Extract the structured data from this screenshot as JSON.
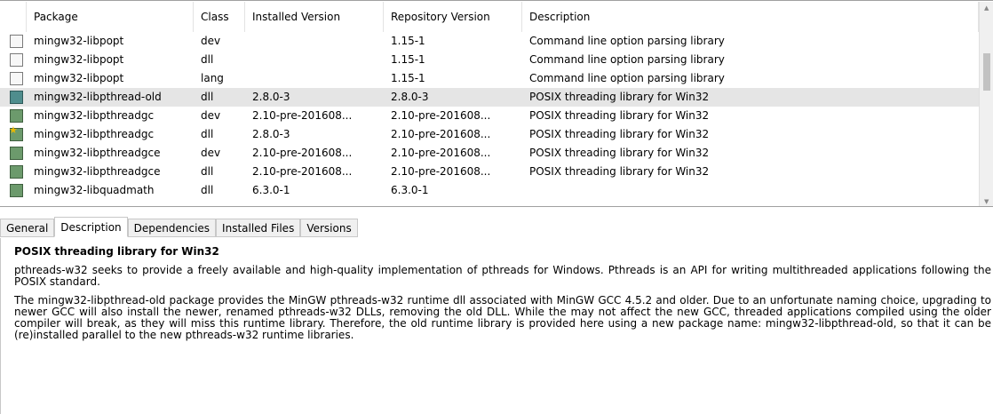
{
  "table": {
    "columns": [
      "Package",
      "Class",
      "Installed Version",
      "Repository Version",
      "Description"
    ],
    "rows": [
      {
        "state": "empty",
        "package": "mingw32-libpopt",
        "class": "dev",
        "installed": "",
        "repository": "1.15-1",
        "description": "Command line option parsing library"
      },
      {
        "state": "empty",
        "package": "mingw32-libpopt",
        "class": "dll",
        "installed": "",
        "repository": "1.15-1",
        "description": "Command line option parsing library"
      },
      {
        "state": "empty",
        "package": "mingw32-libpopt",
        "class": "lang",
        "installed": "",
        "repository": "1.15-1",
        "description": "Command line option parsing library"
      },
      {
        "state": "selected-inst",
        "package": "mingw32-libpthread-old",
        "class": "dll",
        "installed": "2.8.0-3",
        "repository": "2.8.0-3",
        "description": "POSIX threading library for Win32"
      },
      {
        "state": "installed",
        "package": "mingw32-libpthreadgc",
        "class": "dev",
        "installed": "2.10-pre-201608...",
        "repository": "2.10-pre-201608...",
        "description": "POSIX threading library for Win32"
      },
      {
        "state": "upgrade",
        "package": "mingw32-libpthreadgc",
        "class": "dll",
        "installed": "2.8.0-3",
        "repository": "2.10-pre-201608...",
        "description": "POSIX threading library for Win32"
      },
      {
        "state": "installed",
        "package": "mingw32-libpthreadgce",
        "class": "dev",
        "installed": "2.10-pre-201608...",
        "repository": "2.10-pre-201608...",
        "description": "POSIX threading library for Win32"
      },
      {
        "state": "installed",
        "package": "mingw32-libpthreadgce",
        "class": "dll",
        "installed": "2.10-pre-201608...",
        "repository": "2.10-pre-201608...",
        "description": "POSIX threading library for Win32"
      },
      {
        "state": "installed",
        "package": "mingw32-libquadmath",
        "class": "dll",
        "installed": "6.3.0-1",
        "repository": "6.3.0-1",
        "description": ""
      }
    ]
  },
  "tabs": [
    "General",
    "Description",
    "Dependencies",
    "Installed Files",
    "Versions"
  ],
  "active_tab": "Description",
  "description": {
    "title": "POSIX threading library for Win32",
    "para1": "pthreads-w32 seeks to provide a freely available and high-quality implementation of pthreads for Windows. Pthreads is an API for writing multithreaded applications following the POSIX standard.",
    "para2": "The mingw32-libpthread-old package provides the MinGW pthreads-w32 runtime dll associated with MinGW GCC 4.5.2 and older. Due to an unfortunate naming choice, upgrading to newer GCC will also install the newer, renamed pthreads-w32 DLLs, removing the old DLL. While the may not affect the new GCC, threaded applications compiled using the older compiler will break, as they will miss this runtime library. Therefore, the old runtime library is provided here using a new package name: mingw32-libpthread-old, so that it can be (re)installed parallel to the new pthreads-w32 runtime libraries."
  },
  "colors": {
    "installed": "#6c9a6c",
    "selected_installed": "#4f8d8d",
    "selection_row": "#e5e5e5"
  }
}
